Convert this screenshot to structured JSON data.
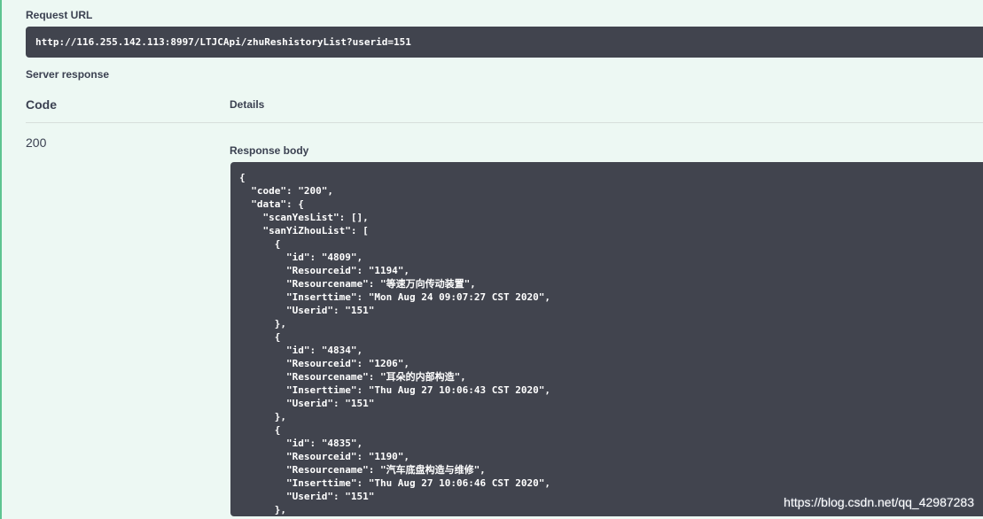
{
  "request": {
    "label": "Request URL",
    "url": "http://116.255.142.113:8997/LTJCApi/zhuReshistoryList?userid=151"
  },
  "server_response": {
    "label": "Server response",
    "code_header": "Code",
    "details_header": "Details",
    "status_code": "200",
    "response_body_label": "Response body",
    "body_lines": [
      "{",
      "  \"code\": \"200\",",
      "  \"data\": {",
      "    \"scanYesList\": [],",
      "    \"sanYiZhouList\": [",
      "      {",
      "        \"id\": \"4809\",",
      "        \"Resourceid\": \"1194\",",
      "        \"Resourcename\": \"等速万向传动装置\",",
      "        \"Inserttime\": \"Mon Aug 24 09:07:27 CST 2020\",",
      "        \"Userid\": \"151\"",
      "      },",
      "      {",
      "        \"id\": \"4834\",",
      "        \"Resourceid\": \"1206\",",
      "        \"Resourcename\": \"耳朵的内部构造\",",
      "        \"Inserttime\": \"Thu Aug 27 10:06:43 CST 2020\",",
      "        \"Userid\": \"151\"",
      "      },",
      "      {",
      "        \"id\": \"4835\",",
      "        \"Resourceid\": \"1190\",",
      "        \"Resourcename\": \"汽车底盘构造与维修\",",
      "        \"Inserttime\": \"Thu Aug 27 10:06:46 CST 2020\",",
      "        \"Userid\": \"151\"",
      "      },"
    ]
  },
  "watermark": "https://blog.csdn.net/qq_42987283",
  "colors": {
    "panel_bg": "#edf8f3",
    "panel_border": "#5ec491",
    "code_bg": "#41444e",
    "text": "#3b4151"
  }
}
